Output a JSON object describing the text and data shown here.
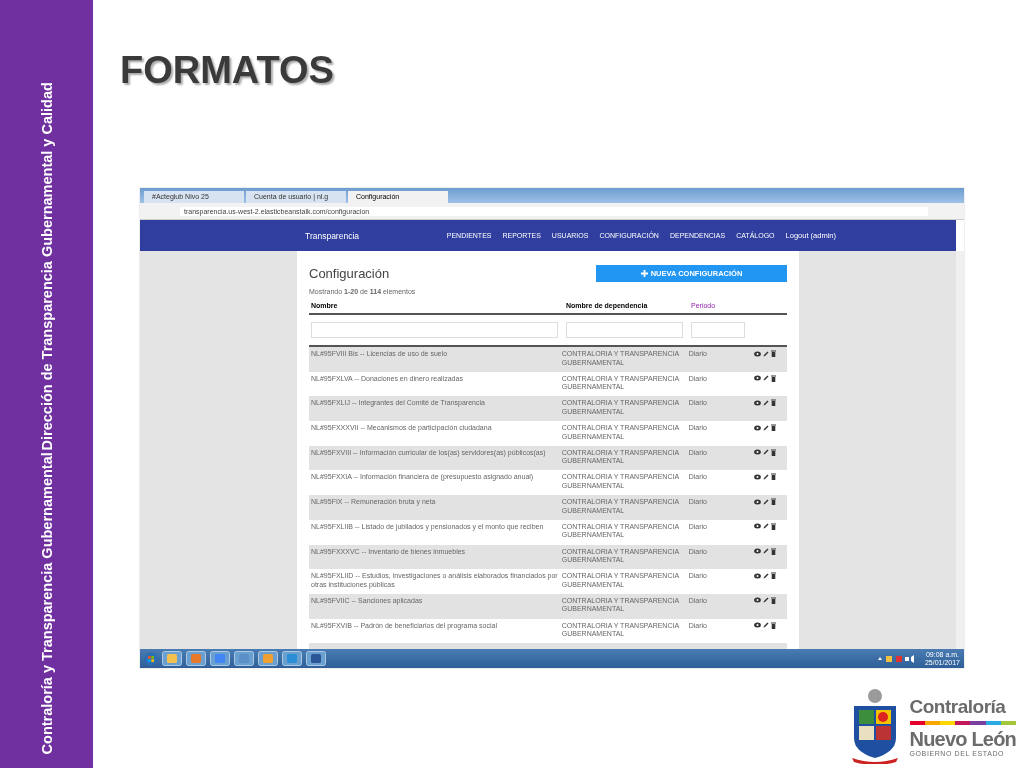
{
  "sidebar_lines": [
    "Contraloría  y Transparencia Gubernamental",
    "Dirección de Transparencia Gubernamental y Calidad"
  ],
  "title": "FORMATOS",
  "screenshot": {
    "browser_tabs": [
      {
        "label": "#Acteglub Nivo 25",
        "selected": false
      },
      {
        "label": "Cuenta de usuario | nl.g",
        "selected": false
      },
      {
        "label": "Configuración",
        "selected": true
      }
    ],
    "url": "transparencia.us-west-2.elasticbeanstalk.com/configuracion",
    "brand": "Transparencia",
    "nav": [
      "PENDIENTES",
      "REPORTES",
      "USUARIOS",
      "CONFIGURACIÓN",
      "DEPENDENCIAS",
      "CATÁLOGO",
      "Logout (admin)"
    ],
    "page_title": "Configuración",
    "new_button": "NUEVA CONFIGURACIÓN",
    "summary": "Mostrando **1-20** de **114** elementos",
    "columns": [
      {
        "label": "Nombre",
        "sorted": false
      },
      {
        "label": "Nombre de dependencia",
        "sorted": false
      },
      {
        "label": "Periodo",
        "sorted": true
      }
    ],
    "rows": [
      {
        "name": "NL#95FVIII Bis -- Licencias de uso de suelo",
        "dependency": "CONTRALORIA Y TRANSPARENCIA GUBERNAMENTAL",
        "period": "Diario"
      },
      {
        "name": "NL#95FXLVA -- Donaciones en dinero realizadas",
        "dependency": "CONTRALORIA Y TRANSPARENCIA GUBERNAMENTAL",
        "period": "Diario"
      },
      {
        "name": "NL#95FXLIJ -- Integrantes del Comité de Transparencia",
        "dependency": "CONTRALORIA Y TRANSPARENCIA GUBERNAMENTAL",
        "period": "Diario"
      },
      {
        "name": "NL#95FXXXVII -- Mecanismos de participación ciudadana",
        "dependency": "CONTRALORIA Y TRANSPARENCIA GUBERNAMENTAL",
        "period": "Diario"
      },
      {
        "name": "NL#95FXVIII -- Información curricular de los(as) servidores(as) públicos(as)",
        "dependency": "CONTRALORIA Y TRANSPARENCIA GUBERNAMENTAL",
        "period": "Diario"
      },
      {
        "name": "NL#95FXXIA -- Información financiera de (presupuesto asignado anual)",
        "dependency": "CONTRALORIA Y TRANSPARENCIA GUBERNAMENTAL",
        "period": "Diario"
      },
      {
        "name": "NL#95FIX -- Remuneración bruta y neta",
        "dependency": "CONTRALORIA Y TRANSPARENCIA GUBERNAMENTAL",
        "period": "Diario"
      },
      {
        "name": "NL#95FXLIIB -- Listado de jubilados y pensionados y el monto que reciben",
        "dependency": "CONTRALORIA Y TRANSPARENCIA GUBERNAMENTAL",
        "period": "Diario"
      },
      {
        "name": "NL#95FXXXVC -- Inventario de bienes inmuebles",
        "dependency": "CONTRALORIA Y TRANSPARENCIA GUBERNAMENTAL",
        "period": "Diario"
      },
      {
        "name": "NL#95FXLIID -- Estudios, investigaciones o análisis elaborados financiados por otras instituciones públicas",
        "dependency": "CONTRALORIA Y TRANSPARENCIA GUBERNAMENTAL",
        "period": "Diario"
      },
      {
        "name": "NL#95FVIIC -- Sanciones aplicadas",
        "dependency": "CONTRALORIA Y TRANSPARENCIA GUBERNAMENTAL",
        "period": "Diario"
      },
      {
        "name": "NL#95FXVIB -- Padrón de beneficiarios del programa social",
        "dependency": "CONTRALORIA Y TRANSPARENCIA GUBERNAMENTAL",
        "period": "Diario"
      }
    ],
    "taskbar": {
      "time": "09:08 a.m.",
      "date": "25/01/2017"
    }
  },
  "logo": {
    "name": "Contraloría",
    "state": "Nuevo León",
    "tagline": "GOBIERNO DEL ESTADO"
  }
}
